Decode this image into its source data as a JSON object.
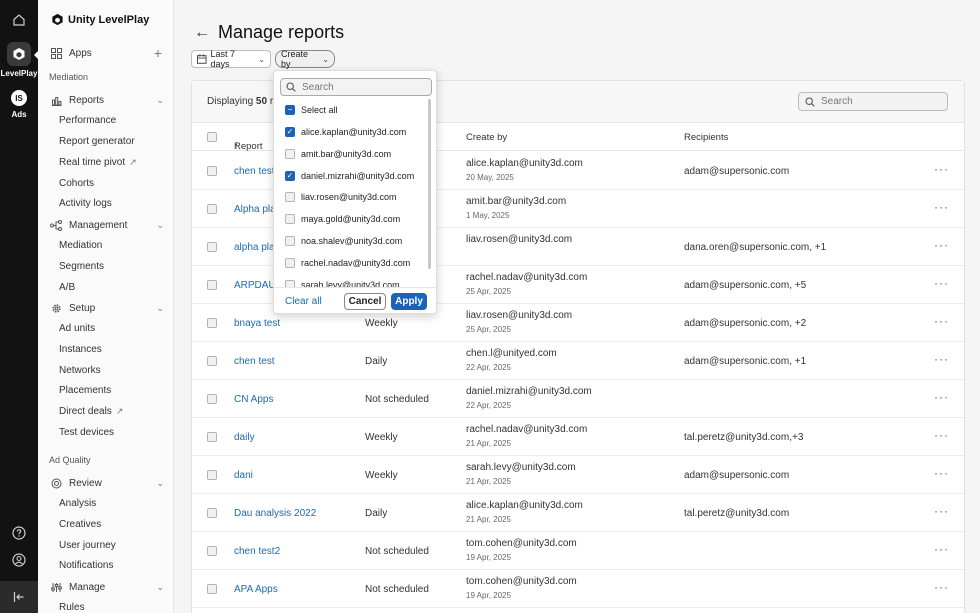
{
  "rail": {
    "levelplay_label": "LevelPlay",
    "ads_badge": "IS",
    "ads_label": "Ads"
  },
  "sidebar": {
    "brand": "Unity LevelPlay",
    "apps": "Apps",
    "section_mediation": "Mediation",
    "reports": {
      "label": "Reports",
      "items": [
        "Performance",
        "Report generator",
        "Real time pivot",
        "Cohorts",
        "Activity logs"
      ]
    },
    "management": {
      "label": "Management",
      "items": [
        "Mediation",
        "Segments",
        "A/B"
      ]
    },
    "setup": {
      "label": "Setup",
      "items": [
        "Ad units",
        "Instances",
        "Networks",
        "Placements",
        "Direct deals",
        "Test devices"
      ]
    },
    "section_ad_quality": "Ad Quality",
    "review": {
      "label": "Review",
      "items": [
        "Analysis",
        "Creatives",
        "User journey",
        "Notifications"
      ]
    },
    "manage": {
      "label": "Manage",
      "items": [
        "Rules"
      ]
    }
  },
  "page": {
    "title": "Manage reports",
    "date_filter": "Last 7 days",
    "create_by_filter": "Create by",
    "displaying_prefix": "Displaying",
    "displaying_count": "50",
    "displaying_suffix": "r",
    "search_placeholder": "Search"
  },
  "table": {
    "headers": {
      "report": "Report",
      "create_by": "Create by",
      "recipients": "Recipients"
    },
    "rows": [
      {
        "name": "chen test",
        "schedule": "",
        "created_by": "alice.kaplan@unity3d.com",
        "date": "20 May, 2025",
        "recipients": "adam@supersonic.com"
      },
      {
        "name": "Alpha plat",
        "schedule": "",
        "created_by": "amit.bar@unity3d.com",
        "date": "1 May, 2025",
        "recipients": ""
      },
      {
        "name": "alpha plat",
        "schedule": "",
        "created_by": "liav.rosen@unity3d.com",
        "date": "",
        "recipients": "dana.oren@supersonic.com, +1"
      },
      {
        "name": "ARPDAU",
        "schedule": "",
        "created_by": "rachel.nadav@unity3d.com",
        "date": "25 Apr, 2025",
        "recipients": "adam@supersonic.com, +5"
      },
      {
        "name": "bnaya test",
        "schedule": "Weekly",
        "created_by": "liav.rosen@unity3d.com",
        "date": "25 Apr, 2025",
        "recipients": "adam@supersonic.com, +2"
      },
      {
        "name": "chen test",
        "schedule": "Daily",
        "created_by": "chen.l@unityed.com",
        "date": "22 Apr, 2025",
        "recipients": "adam@supersonic.com, +1"
      },
      {
        "name": "CN Apps",
        "schedule": "Not scheduled",
        "created_by": "daniel.mizrahi@unity3d.com",
        "date": "22 Apr, 2025",
        "recipients": ""
      },
      {
        "name": "daily",
        "schedule": "Weekly",
        "created_by": "rachel.nadav@unity3d.com",
        "date": "21 Apr, 2025",
        "recipients": "tal.peretz@unity3d.com,+3"
      },
      {
        "name": "dani",
        "schedule": "Weekly",
        "created_by": "sarah.levy@unity3d.com",
        "date": "21 Apr, 2025",
        "recipients": "adam@supersonic.com"
      },
      {
        "name": "Dau analysis 2022",
        "schedule": "Daily",
        "created_by": "alice.kaplan@unity3d.com",
        "date": "21 Apr, 2025",
        "recipients": "tal.peretz@unity3d.com"
      },
      {
        "name": "chen test2",
        "schedule": "Not scheduled",
        "created_by": "tom.cohen@unity3d.com",
        "date": "19 Apr, 2025",
        "recipients": ""
      },
      {
        "name": "APA Apps",
        "schedule": "Not scheduled",
        "created_by": "tom.cohen@unity3d.com",
        "date": "19 Apr, 2025",
        "recipients": ""
      }
    ],
    "more_label": "···"
  },
  "dropdown": {
    "search_placeholder": "Search",
    "select_all": "Select all",
    "options": [
      {
        "label": "alice.kaplan@unity3d.com",
        "checked": true
      },
      {
        "label": "amit.bar@unity3d.com",
        "checked": false
      },
      {
        "label": "daniel.mizrahi@unity3d.com",
        "checked": true
      },
      {
        "label": "liav.rosen@unity3d.com",
        "checked": false
      },
      {
        "label": "maya.gold@unity3d.com",
        "checked": false
      },
      {
        "label": "noa.shalev@unity3d.com",
        "checked": false
      },
      {
        "label": "rachel.nadav@unity3d.com",
        "checked": false
      },
      {
        "label": "sarah.levy@unity3d.com",
        "checked": false
      }
    ],
    "clear_all": "Clear all",
    "cancel": "Cancel",
    "apply": "Apply"
  },
  "colors": {
    "accent": "#1c63b8",
    "link": "#1a6bb5",
    "rail": "#121212"
  }
}
